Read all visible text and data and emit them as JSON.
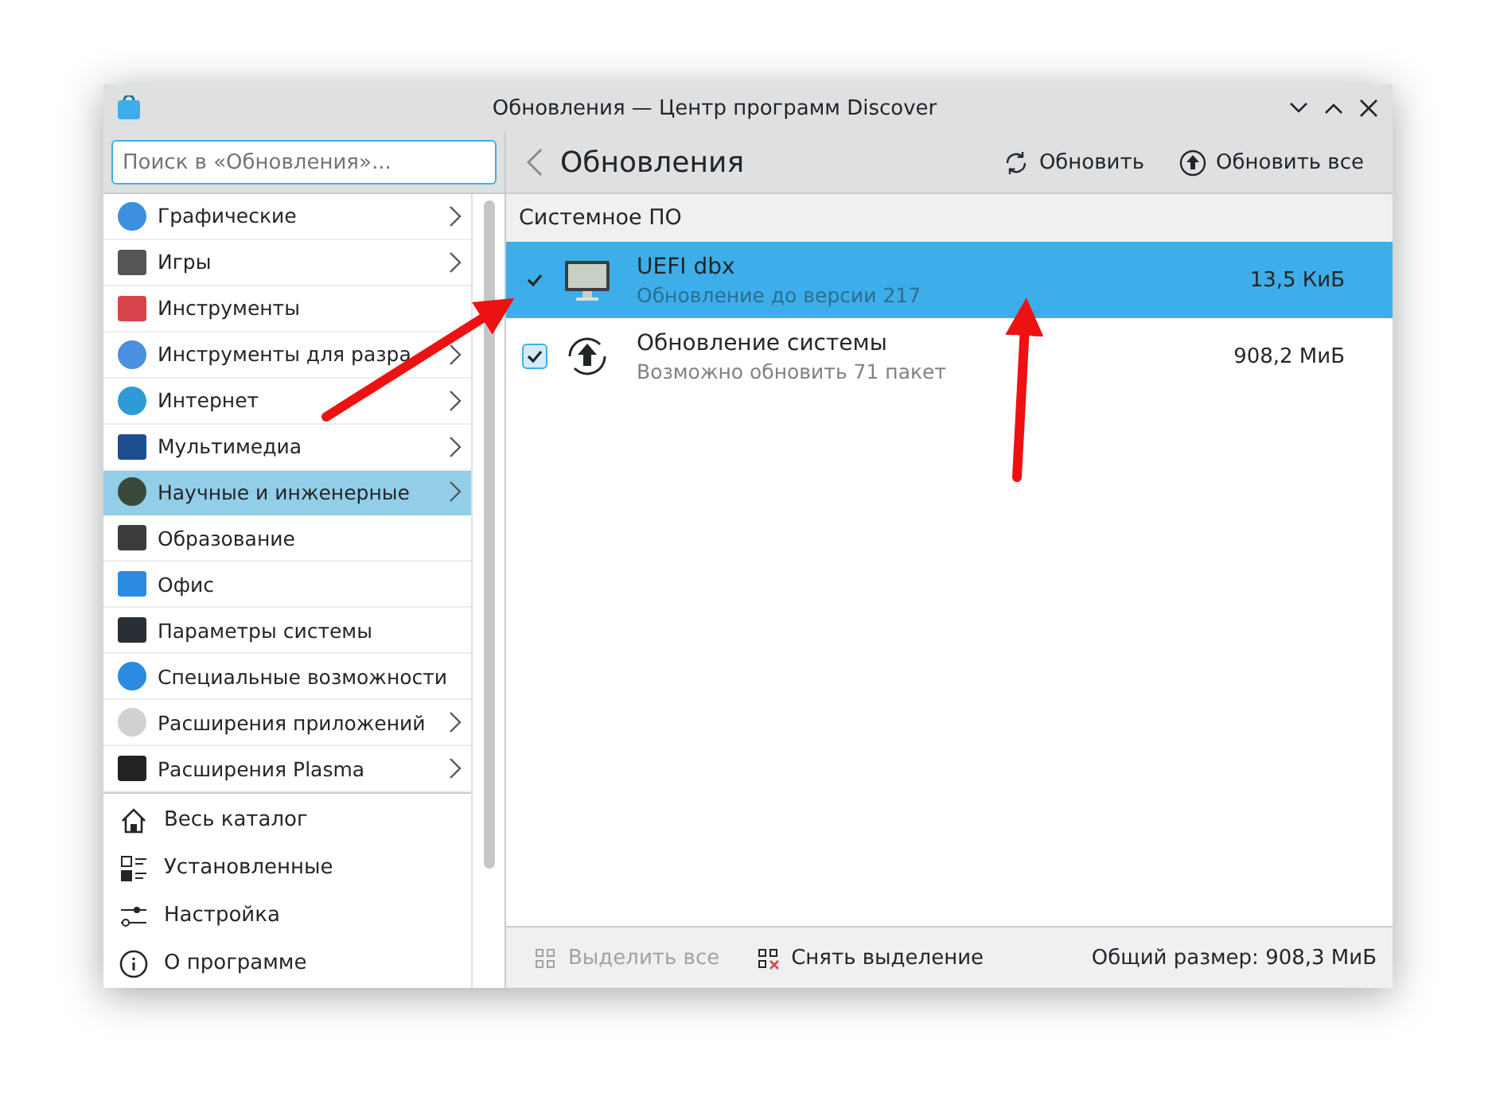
{
  "window": {
    "title": "Обновления — Центр программ Discover"
  },
  "search": {
    "placeholder": "Поиск в «Обновления»..."
  },
  "categories": [
    {
      "label": "Графические",
      "has_children": true,
      "selected": false
    },
    {
      "label": "Игры",
      "has_children": true,
      "selected": false
    },
    {
      "label": "Инструменты",
      "has_children": false,
      "selected": false
    },
    {
      "label": "Инструменты для разра",
      "has_children": true,
      "selected": false
    },
    {
      "label": "Интернет",
      "has_children": true,
      "selected": false
    },
    {
      "label": "Мультимедиа",
      "has_children": true,
      "selected": false
    },
    {
      "label": "Научные и инженерные",
      "has_children": true,
      "selected": true
    },
    {
      "label": "Образование",
      "has_children": false,
      "selected": false
    },
    {
      "label": "Офис",
      "has_children": false,
      "selected": false
    },
    {
      "label": "Параметры системы",
      "has_children": false,
      "selected": false
    },
    {
      "label": "Специальные возможности",
      "has_children": false,
      "selected": false
    },
    {
      "label": "Расширения приложений",
      "has_children": true,
      "selected": false
    },
    {
      "label": "Расширения Plasma",
      "has_children": true,
      "selected": false
    }
  ],
  "nav": [
    {
      "label": "Весь каталог"
    },
    {
      "label": "Установленные"
    },
    {
      "label": "Настройка"
    },
    {
      "label": "О программе"
    }
  ],
  "page": {
    "title": "Обновления",
    "actions": [
      {
        "label": "Обновить"
      },
      {
        "label": "Обновить все"
      }
    ]
  },
  "section": "Системное ПО",
  "updates": [
    {
      "name": "UEFI dbx",
      "description": "Обновление до версии 217",
      "size": "13,5 КиБ",
      "checked": true,
      "selected": true
    },
    {
      "name": "Обновление системы",
      "description": "Возможно обновить 71 пакет",
      "size": "908,2 МиБ",
      "checked": true,
      "selected": false
    }
  ],
  "footer": {
    "select_all": {
      "label": "Выделить все",
      "disabled": true
    },
    "deselect": {
      "label": "Снять выделение",
      "disabled": false
    },
    "total": "Общий размер: 908,3 МиБ"
  }
}
